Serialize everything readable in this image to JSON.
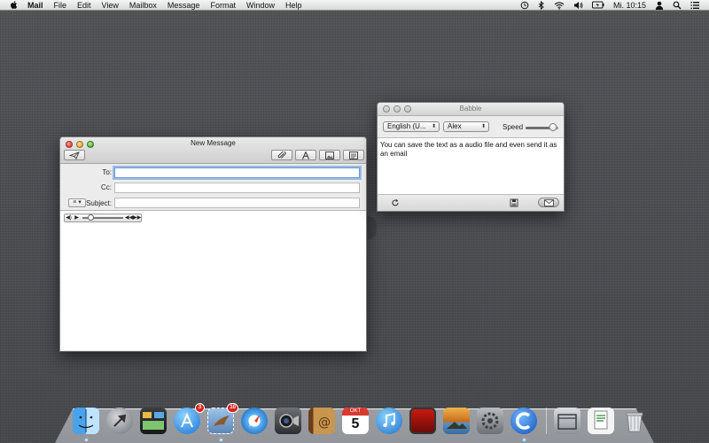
{
  "menubar": {
    "app_name": "Mail",
    "items": [
      "File",
      "Edit",
      "View",
      "Mailbox",
      "Message",
      "Format",
      "Window",
      "Help"
    ],
    "status_icons": [
      "time-machine-icon",
      "bluetooth-icon",
      "wifi-icon",
      "volume-icon",
      "battery-icon",
      "user-icon",
      "spotlight-icon",
      "notification-center-icon"
    ],
    "clock": "Mi. 10:15"
  },
  "mail_window": {
    "title": "New Message",
    "toolbar_buttons": [
      "send-icon",
      "attach-icon",
      "format-text-icon",
      "photo-browser-icon",
      "stationery-icon"
    ],
    "fields": {
      "to_label": "To:",
      "to_value": "",
      "cc_label": "Cc:",
      "cc_value": "",
      "subject_label": "Subject:",
      "subject_value": "",
      "priority_selector": "≡ ▾"
    },
    "audio_player": {
      "icons": [
        "volume-icon",
        "play-icon",
        "rewind-icon",
        "forward-icon"
      ],
      "progress": 0.12
    }
  },
  "babble_window": {
    "title": "Babble",
    "language_select": "English (U...",
    "voice_select": "Alex",
    "speed_label": "Speed",
    "speed_value": 0.85,
    "text": "You can save the text as a audio file and even send it as an email",
    "bottom_buttons": [
      "speak-icon",
      "save-audio-icon",
      "send-email-icon"
    ]
  },
  "dock": {
    "apps": [
      {
        "icon": "finder-icon",
        "running": true
      },
      {
        "icon": "launchpad-icon",
        "running": false
      },
      {
        "icon": "mission-control-icon",
        "running": false
      },
      {
        "icon": "app-store-icon",
        "badge": "3",
        "running": false
      },
      {
        "icon": "mail-stamp-icon",
        "badge": "10",
        "running": true
      },
      {
        "icon": "safari-icon",
        "running": false
      },
      {
        "icon": "facetime-icon",
        "running": false
      },
      {
        "icon": "contacts-icon",
        "running": false
      },
      {
        "icon": "calendar-icon",
        "calendar_month": "OKT",
        "calendar_day": "5",
        "running": false
      },
      {
        "icon": "itunes-icon",
        "running": false
      },
      {
        "icon": "photo-booth-icon",
        "running": false
      },
      {
        "icon": "iphoto-icon",
        "running": false
      },
      {
        "icon": "system-preferences-icon",
        "running": false
      },
      {
        "icon": "babble-app-icon",
        "running": true
      }
    ],
    "stacks": [
      {
        "icon": "applications-folder-icon"
      },
      {
        "icon": "documents-stack-icon"
      },
      {
        "icon": "trash-icon"
      }
    ]
  },
  "colors": {
    "desktop": "#4a4c50",
    "focus_ring": "#6a9ad6",
    "badge_red": "#d8231c"
  }
}
